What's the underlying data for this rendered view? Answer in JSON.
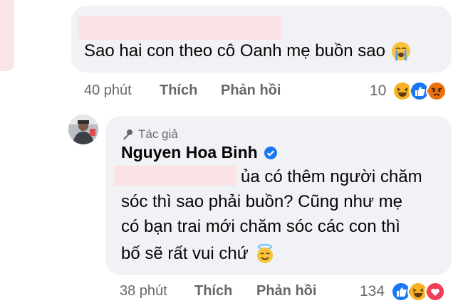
{
  "comment1": {
    "text": "Sao hai con theo cô Oanh mẹ buồn sao",
    "time": "40 phút",
    "like_label": "Thích",
    "reply_label": "Phản hồi",
    "reaction_count": "10",
    "reactions": [
      "haha",
      "like",
      "angry"
    ]
  },
  "comment2": {
    "author_tag": "Tác giả",
    "author_name": "Nguyen Hoa Binh",
    "line1": "ủa có thêm người chăm",
    "line2": "sóc thì sao phải buồn? Cũng như mẹ",
    "line3": "có bạn trai mới chăm sóc các con thì",
    "line4": "bố sẽ rất vui chứ",
    "time": "38 phút",
    "like_label": "Thích",
    "reply_label": "Phản hồi",
    "reaction_count": "134",
    "reactions": [
      "like",
      "haha",
      "love"
    ]
  },
  "colors": {
    "bubble": "#f0f2f5",
    "meta_text": "#65676b",
    "like_blue": "#1877f2",
    "love_red": "#f33e58",
    "haha_yellow": "#f7b125",
    "verified_blue": "#1877f2"
  }
}
